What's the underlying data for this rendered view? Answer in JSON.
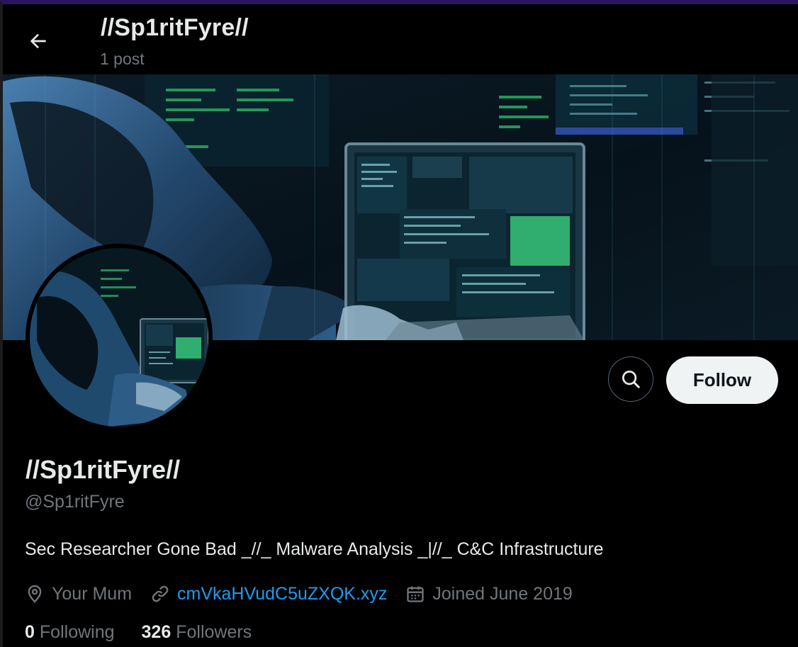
{
  "header": {
    "title": "//Sp1ritFyre//",
    "posts": "1 post"
  },
  "icons": {
    "back": "arrow-left-icon",
    "search": "search-icon",
    "location": "location-pin-icon",
    "link": "link-icon",
    "calendar": "calendar-icon"
  },
  "actions": {
    "follow_label": "Follow"
  },
  "profile": {
    "display_name": "//Sp1ritFyre//",
    "handle": "@Sp1ritFyre",
    "bio": "Sec Researcher Gone Bad _//_ Malware Analysis _|//_ C&C Infrastructure",
    "location": "Your Mum",
    "website": "cmVkaHVudC5uZXQK.xyz",
    "joined": "Joined June 2019"
  },
  "stats": {
    "following_count": "0",
    "following_label": "Following",
    "followers_count": "326",
    "followers_label": "Followers"
  },
  "colors": {
    "background": "#000000",
    "text_primary": "#e7e9ea",
    "text_secondary": "#71767b",
    "link": "#1d9bf0",
    "follow_button_bg": "#eff3f4",
    "window_accent": "#2a1660"
  }
}
